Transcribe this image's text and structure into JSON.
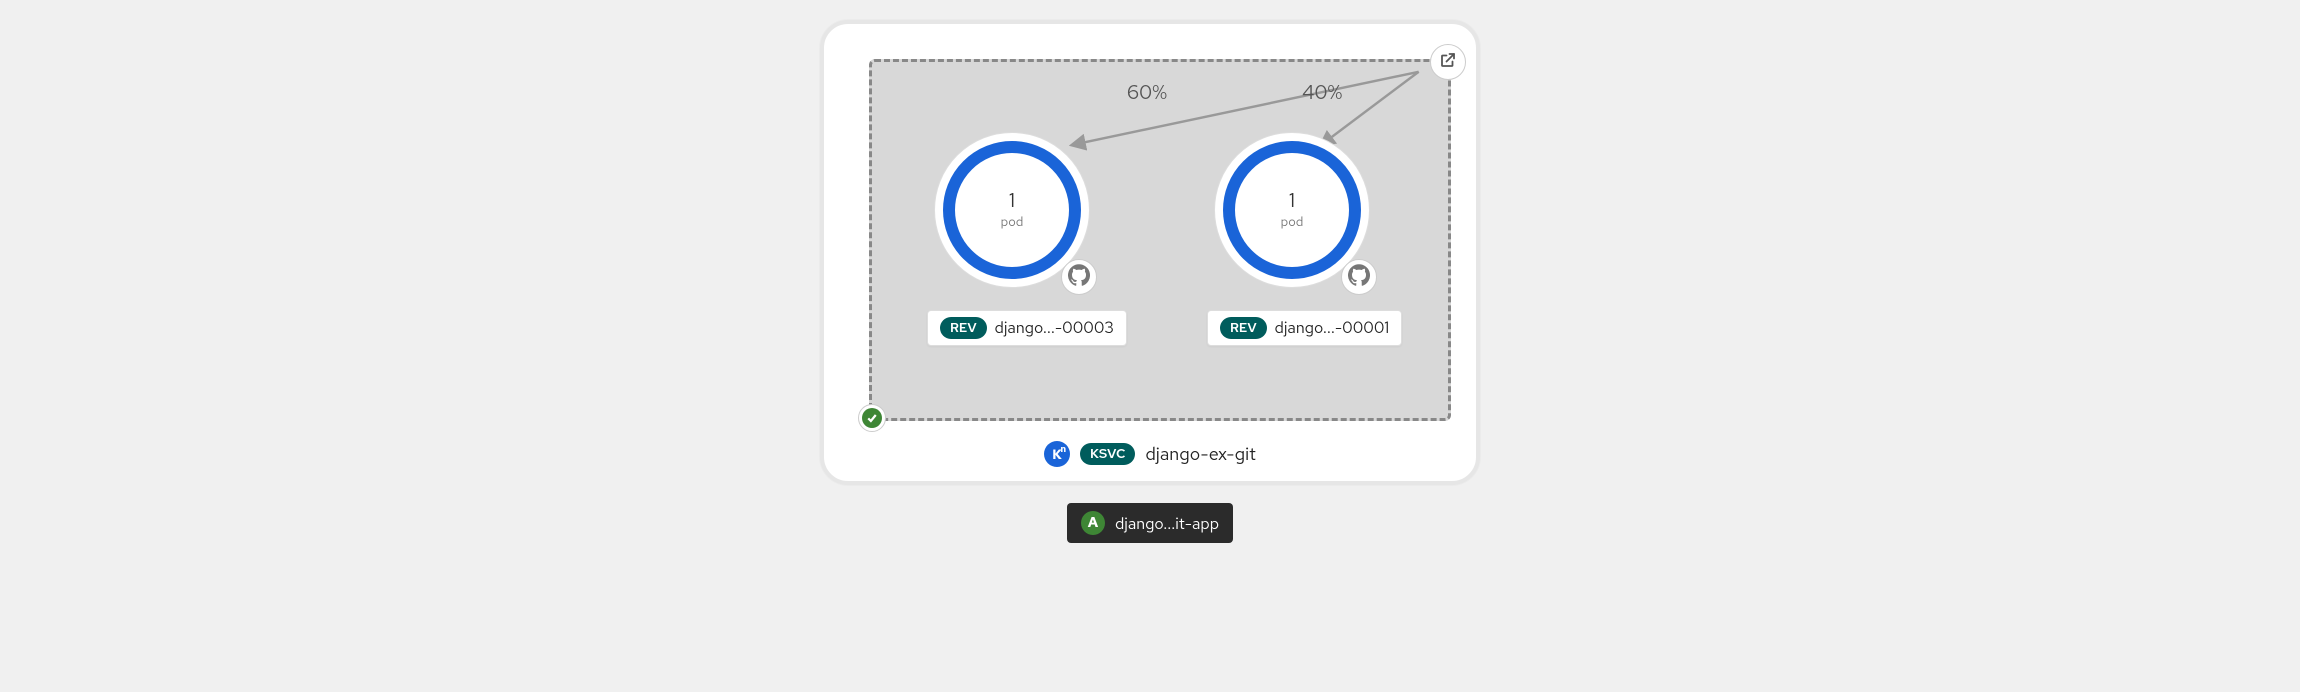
{
  "service": {
    "ksvc_label": "KSVC",
    "ksvc_name": "django-ex-git",
    "knative_icon_text": "K",
    "status": "ok"
  },
  "revisions": [
    {
      "traffic_percent": "60%",
      "pod_count": "1",
      "pod_word": "pod",
      "badge": "REV",
      "name": "django...-00003",
      "source_icon": "github"
    },
    {
      "traffic_percent": "40%",
      "pod_count": "1",
      "pod_word": "pod",
      "badge": "REV",
      "name": "django...-00001",
      "source_icon": "github"
    }
  ],
  "route_icon": "open-url",
  "app": {
    "badge_letter": "A",
    "name": "django...it-app"
  }
}
